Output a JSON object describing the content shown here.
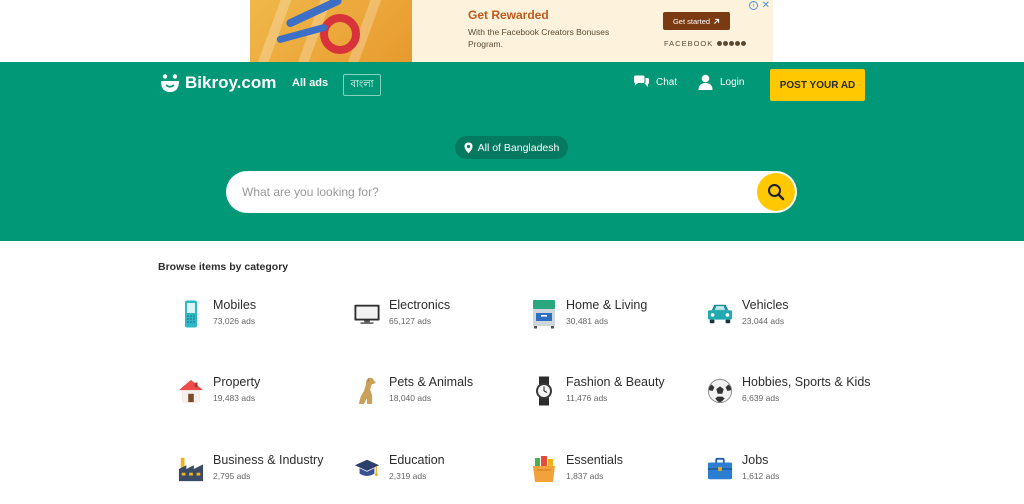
{
  "ad": {
    "title": "Get Rewarded",
    "text": "With the Facebook Creators Bonuses Program.",
    "cta": "Get started",
    "cta_icon": "arrow-up-right-icon",
    "brand": "FACEBOOK"
  },
  "header": {
    "logo": "Bikroy.com",
    "all_ads": "All ads",
    "language": "বাংলা",
    "chat": "Chat",
    "login": "Login",
    "post_ad": "POST YOUR AD"
  },
  "hero": {
    "location": "All of Bangladesh",
    "search_placeholder": "What are you looking for?"
  },
  "browse": {
    "title": "Browse items by category",
    "categories": [
      {
        "name": "Mobiles",
        "count": "73,026 ads",
        "icon": "mobile-icon"
      },
      {
        "name": "Electronics",
        "count": "65,127 ads",
        "icon": "monitor-icon"
      },
      {
        "name": "Home & Living",
        "count": "30,481 ads",
        "icon": "furniture-icon"
      },
      {
        "name": "Vehicles",
        "count": "23,044 ads",
        "icon": "car-icon"
      },
      {
        "name": "Property",
        "count": "19,483 ads",
        "icon": "house-icon"
      },
      {
        "name": "Pets & Animals",
        "count": "18,040 ads",
        "icon": "dog-icon"
      },
      {
        "name": "Fashion & Beauty",
        "count": "11,476 ads",
        "icon": "watch-icon"
      },
      {
        "name": "Hobbies, Sports & Kids",
        "count": "6,639 ads",
        "icon": "football-icon"
      },
      {
        "name": "Business & Industry",
        "count": "2,795 ads",
        "icon": "factory-icon"
      },
      {
        "name": "Education",
        "count": "2,319 ads",
        "icon": "graduation-cap-icon"
      },
      {
        "name": "Essentials",
        "count": "1,837 ads",
        "icon": "grocery-icon"
      },
      {
        "name": "Jobs",
        "count": "1,612 ads",
        "icon": "briefcase-icon"
      }
    ]
  },
  "colors": {
    "brand_green": "#009877",
    "accent_yellow": "#ffc800"
  }
}
